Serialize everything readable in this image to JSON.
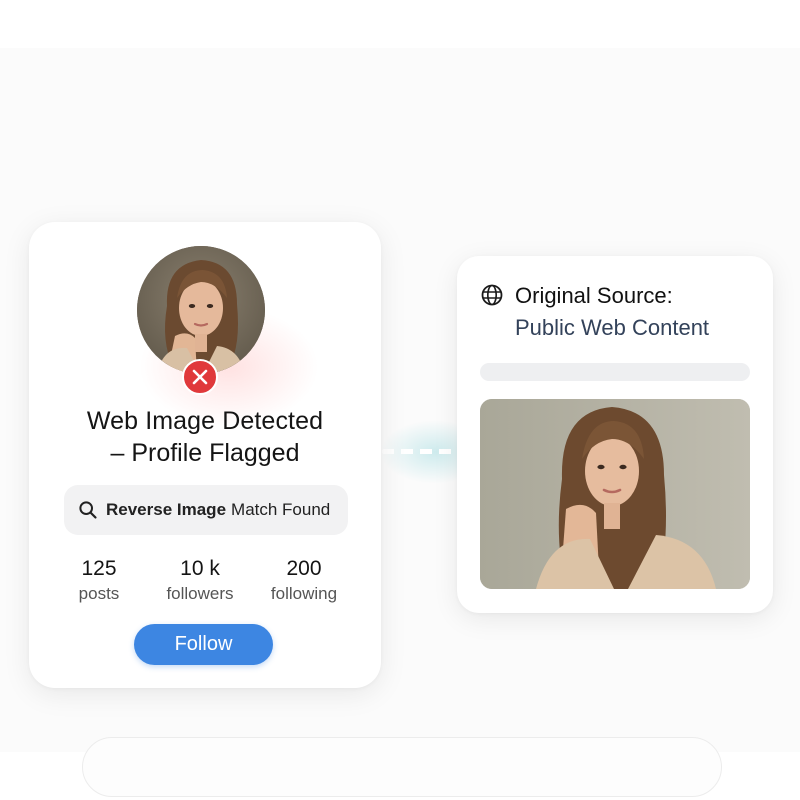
{
  "profile_card": {
    "headline_line1": "Web Image Detected",
    "headline_line2": "– Profile Flagged",
    "match_strong": "Reverse Image",
    "match_rest": "Match Found",
    "stats": [
      {
        "value": "125",
        "label": "posts"
      },
      {
        "value": "10 k",
        "label": "followers"
      },
      {
        "value": "200",
        "label": "following"
      }
    ],
    "follow_label": "Follow",
    "flag_icon": "close-icon",
    "search_icon": "search-icon"
  },
  "source_card": {
    "title": "Original Source:",
    "subtitle": "Public Web Content",
    "icon": "globe-icon"
  },
  "colors": {
    "follow_button": "#3d86e2",
    "flag_badge": "#e0393b",
    "subtitle_text": "#33425a"
  }
}
